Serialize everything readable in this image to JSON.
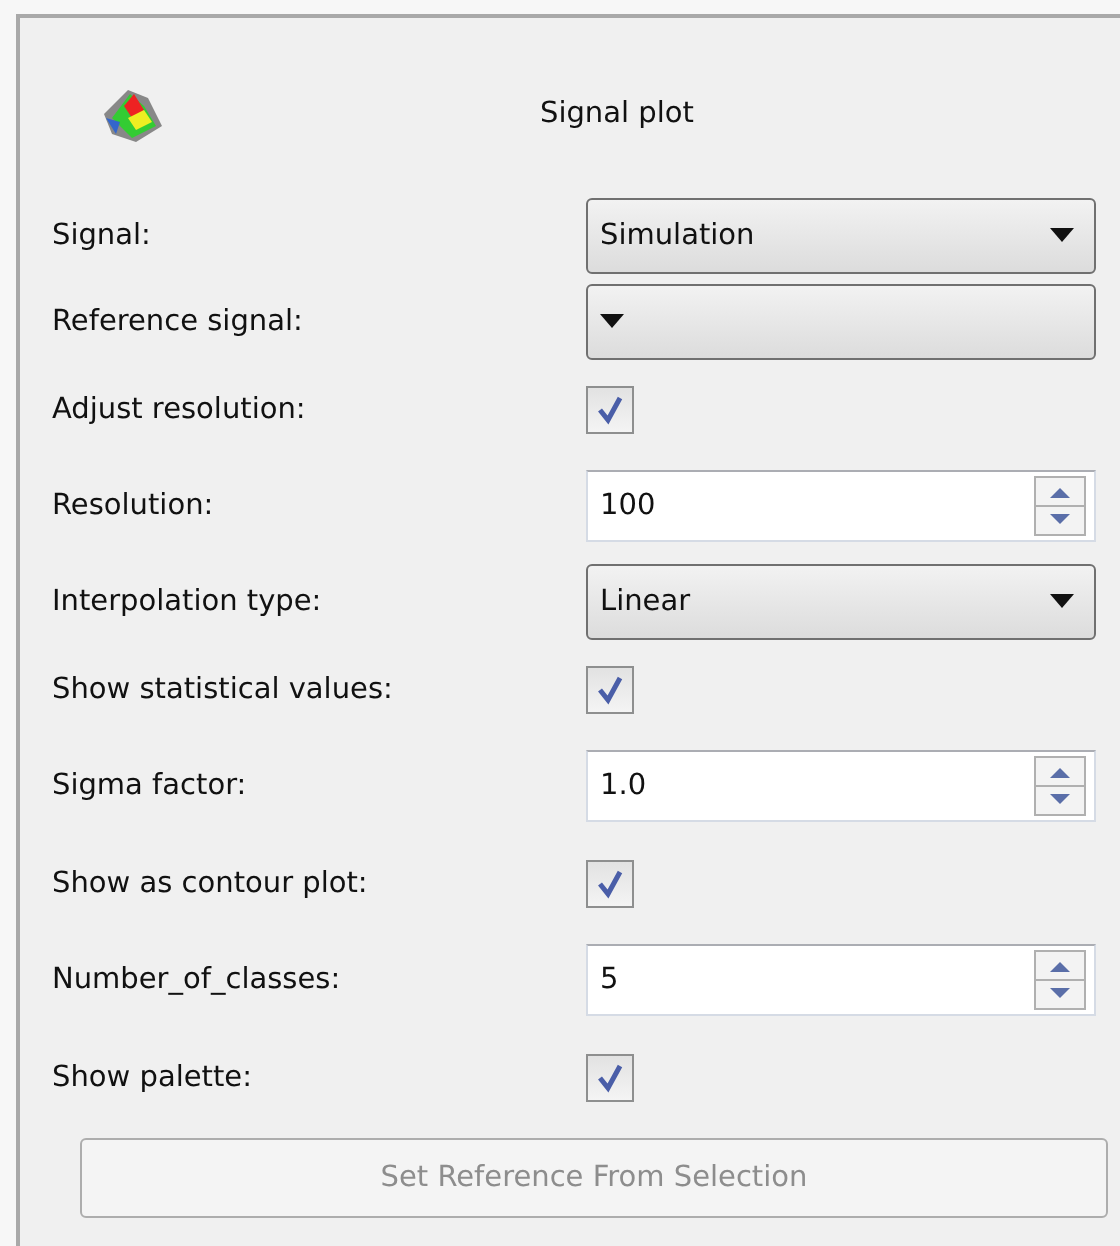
{
  "panel": {
    "title": "Signal plot"
  },
  "fields": [
    {
      "label": "Signal:",
      "kind": "combo",
      "value": "Simulation"
    },
    {
      "label": "Reference signal:",
      "kind": "combo"
    },
    {
      "label": "Adjust resolution:",
      "kind": "checkbox",
      "checked": true
    },
    {
      "label": "Resolution:",
      "kind": "spin",
      "value": "100"
    },
    {
      "label": "Interpolation type:",
      "kind": "combo",
      "value": "Linear"
    },
    {
      "label": "Show statistical values:",
      "kind": "checkbox",
      "checked": true
    },
    {
      "label": "Sigma factor:",
      "kind": "spin",
      "value": "1.0"
    },
    {
      "label": "Show as contour plot:",
      "kind": "checkbox",
      "checked": true
    },
    {
      "label": "Number_of_classes:",
      "kind": "spin",
      "value": "5"
    },
    {
      "label": "Show palette:",
      "kind": "checkbox",
      "checked": true
    }
  ],
  "button": {
    "label": "Set Reference From Selection",
    "disabled": true
  }
}
